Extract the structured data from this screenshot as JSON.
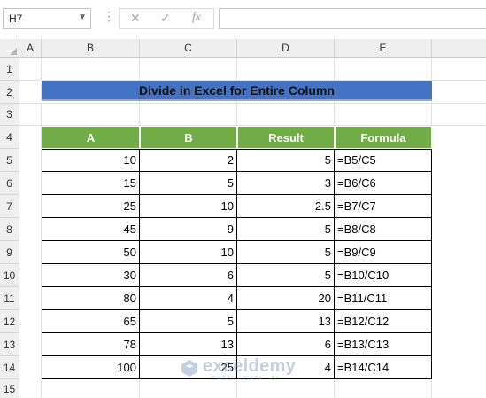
{
  "formula_bar": {
    "name_box": "H7",
    "dots": "⋮",
    "cancel": "✕",
    "confirm": "✓",
    "fx": "fx",
    "formula": ""
  },
  "columns": [
    "A",
    "B",
    "C",
    "D",
    "E"
  ],
  "rows": [
    "1",
    "2",
    "3",
    "4",
    "5",
    "6",
    "7",
    "8",
    "9",
    "10",
    "11",
    "12",
    "13",
    "14",
    "15"
  ],
  "title": "Divide in Excel for Entire Column",
  "table": {
    "headers": [
      "A",
      "B",
      "Result",
      "Formula"
    ],
    "rows": [
      [
        "10",
        "2",
        "5",
        "=B5/C5"
      ],
      [
        "15",
        "5",
        "3",
        "=B6/C6"
      ],
      [
        "25",
        "10",
        "2.5",
        "=B7/C7"
      ],
      [
        "45",
        "9",
        "5",
        "=B8/C8"
      ],
      [
        "50",
        "10",
        "5",
        "=B9/C9"
      ],
      [
        "30",
        "6",
        "5",
        "=B10/C10"
      ],
      [
        "80",
        "4",
        "20",
        "=B11/C11"
      ],
      [
        "65",
        "5",
        "13",
        "=B12/C12"
      ],
      [
        "78",
        "13",
        "6",
        "=B13/C13"
      ],
      [
        "100",
        "25",
        "4",
        "=B14/C14"
      ]
    ]
  },
  "watermark": {
    "name": "exceldemy",
    "tagline": "EXCEL · DATA · BI"
  },
  "colors": {
    "title_bg": "#4472c4",
    "header_bg": "#70ad47"
  }
}
